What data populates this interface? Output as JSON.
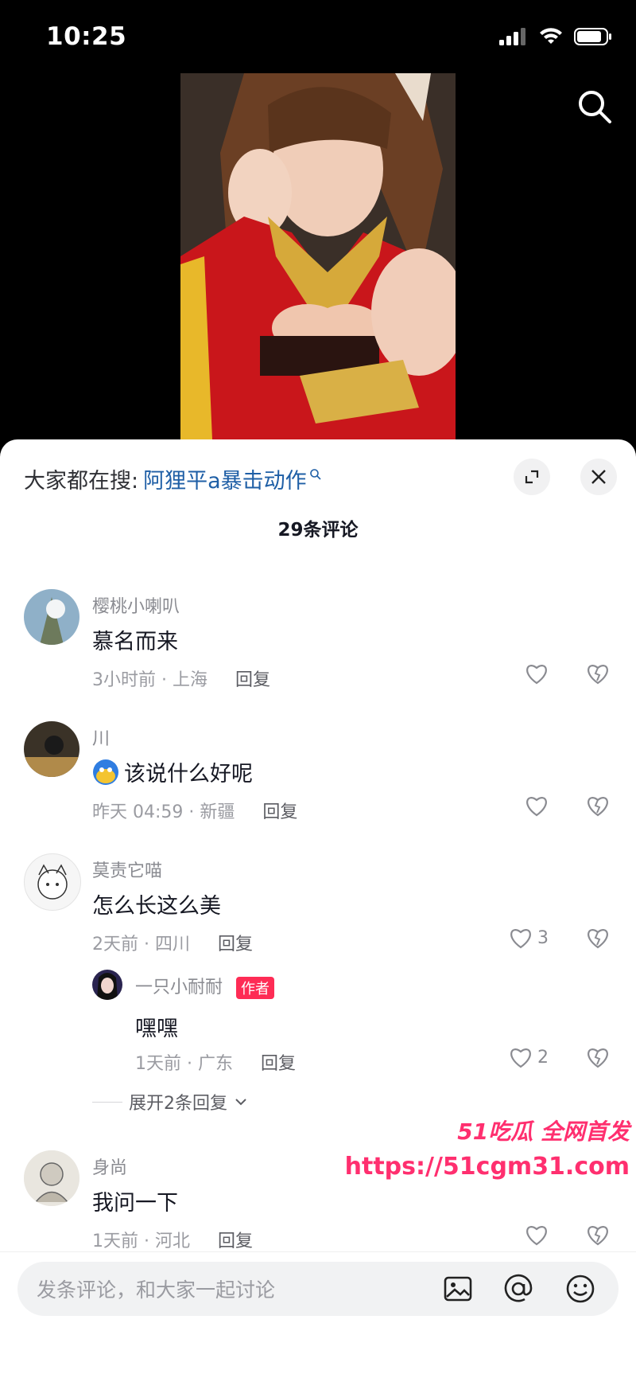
{
  "status": {
    "time": "10:25"
  },
  "sheet": {
    "hot_prefix": "大家都在搜:",
    "hot_term": "阿狸平a暴击动作",
    "comment_count": "29条评论"
  },
  "comments": [
    {
      "name": "樱桃小喇叭",
      "text": "慕名而来",
      "time": "3小时前 · 上海",
      "reply": "回复",
      "likes": ""
    },
    {
      "name": "川",
      "text": "该说什么好呢",
      "time": "昨天 04:59 · 新疆",
      "reply": "回复",
      "likes": ""
    },
    {
      "name": "莫责它喵",
      "text": "怎么长这么美",
      "time": "2天前 · 四川",
      "reply": "回复",
      "likes": "3"
    },
    {
      "name": "身尚",
      "text": "我问一下",
      "time": "1天前 · 河北",
      "reply": "回复",
      "likes": ""
    }
  ],
  "reply_item": {
    "name": "一只小耐耐",
    "tag": "作者",
    "text": "嘿嘿",
    "time": "1天前 · 广东",
    "reply": "回复",
    "likes": "2"
  },
  "expand_label": "展开2条回复",
  "watermark": {
    "line1": "51吃瓜 全网首发",
    "url": "https://51cgm31.com"
  },
  "composer": {
    "placeholder": "发条评论，和大家一起讨论"
  }
}
